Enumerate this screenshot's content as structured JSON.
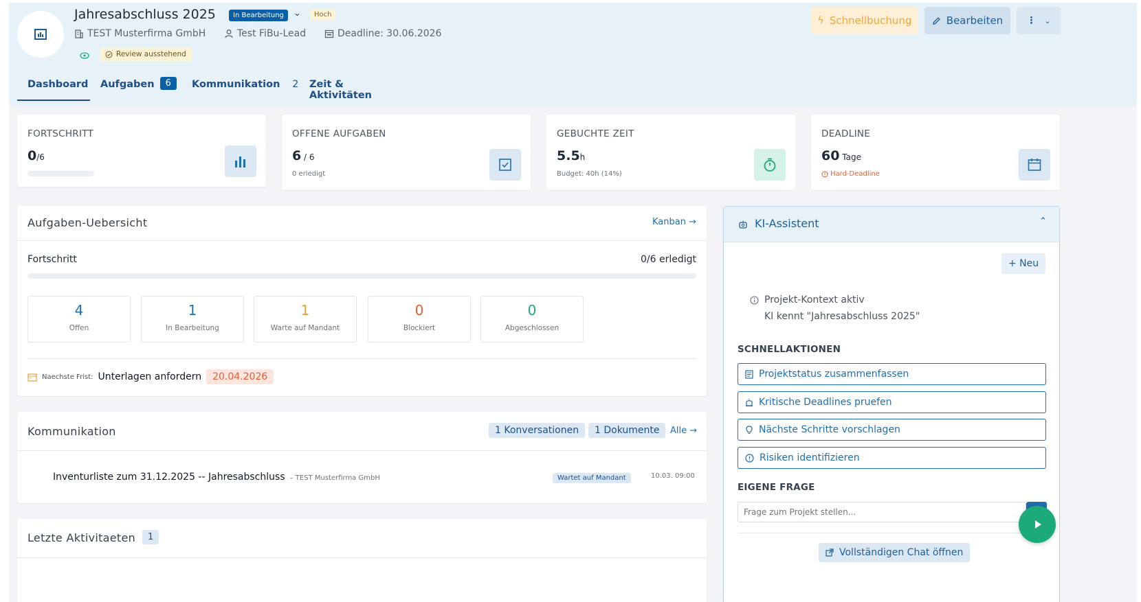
{
  "project": {
    "title": "Jahresabschluss 2025",
    "status": "In Bearbeitung",
    "priority": "Hoch",
    "company": "TEST Musterfirma GmbH",
    "lead": "Test FiBu-Lead",
    "deadline": "Deadline: 30.06.2026",
    "review": "Review ausstehend"
  },
  "actions": {
    "quick_booking": "Schnellbuchung",
    "edit": "Bearbeiten"
  },
  "tabs": [
    {
      "label": "Dashboard",
      "count": ""
    },
    {
      "label": "Aufgaben",
      "count": "6"
    },
    {
      "label": "Kommunikation",
      "count": "2"
    },
    {
      "label": "Zeit & Aktivitäten",
      "count": ""
    }
  ],
  "stats": {
    "progress": {
      "label": "FORTSCHRITT",
      "value": "0",
      "unit": "/6",
      "fraction": 0
    },
    "open_tasks": {
      "label": "OFFENE AUFGABEN",
      "value": "6",
      "unit": " / 6",
      "sub": "0 erledigt"
    },
    "booked_time": {
      "label": "GEBUCHTE ZEIT",
      "value": "5.5",
      "unit": "h",
      "sub": "Budget: 40h (14%)"
    },
    "deadline": {
      "label": "DEADLINE",
      "value": "60",
      "unit": " Tage",
      "sub": "Hard-Deadline"
    }
  },
  "tasks_overview": {
    "title": "Aufgaben-Uebersicht",
    "kanban_link": "Kanban →",
    "progress_label": "Fortschritt",
    "progress_value": "0/6 erledigt",
    "progress_fraction": 0,
    "counters": [
      {
        "num": "4",
        "label": "Offen",
        "color": "#1f6fb0"
      },
      {
        "num": "1",
        "label": "In Bearbeitung",
        "color": "#1f6fb0"
      },
      {
        "num": "1",
        "label": "Warte auf Mandant",
        "color": "#e0a33a"
      },
      {
        "num": "0",
        "label": "Blockiert",
        "color": "#e0603a"
      },
      {
        "num": "0",
        "label": "Abgeschlossen",
        "color": "#1daa7a"
      }
    ],
    "next_deadline_label": "Naechste Frist:",
    "next_deadline_task": "Unterlagen anfordern",
    "next_deadline_date": "20.04.2026"
  },
  "communication": {
    "title": "Kommunikation",
    "conversations": "1 Konversationen",
    "documents": "1 Dokumente",
    "all_link": "Alle →",
    "item_title": "Inventurliste zum 31.12.2025 -- Jahresabschluss",
    "item_company": "– TEST Musterfirma GmbH",
    "item_status": "Wartet auf Mandant",
    "item_time": "10.03. 09:00"
  },
  "activities": {
    "title": "Letzte Aktivitaeten",
    "count": "1"
  },
  "ki": {
    "title": "KI-Assistent",
    "new_button": "+ Neu",
    "context_active": "Projekt-Kontext aktiv",
    "context_desc": "KI kennt \"Jahresabschluss 2025\"",
    "quick_actions_label": "SCHNELLAKTIONEN",
    "quick_actions": [
      "Projektstatus zusammenfassen",
      "Kritische Deadlines pruefen",
      "Nächste Schritte vorschlagen",
      "Risiken identifizieren"
    ],
    "own_question_label": "EIGENE FRAGE",
    "question_placeholder": "Frage zum Projekt stellen...",
    "open_chat": "Vollständigen Chat öffnen"
  }
}
